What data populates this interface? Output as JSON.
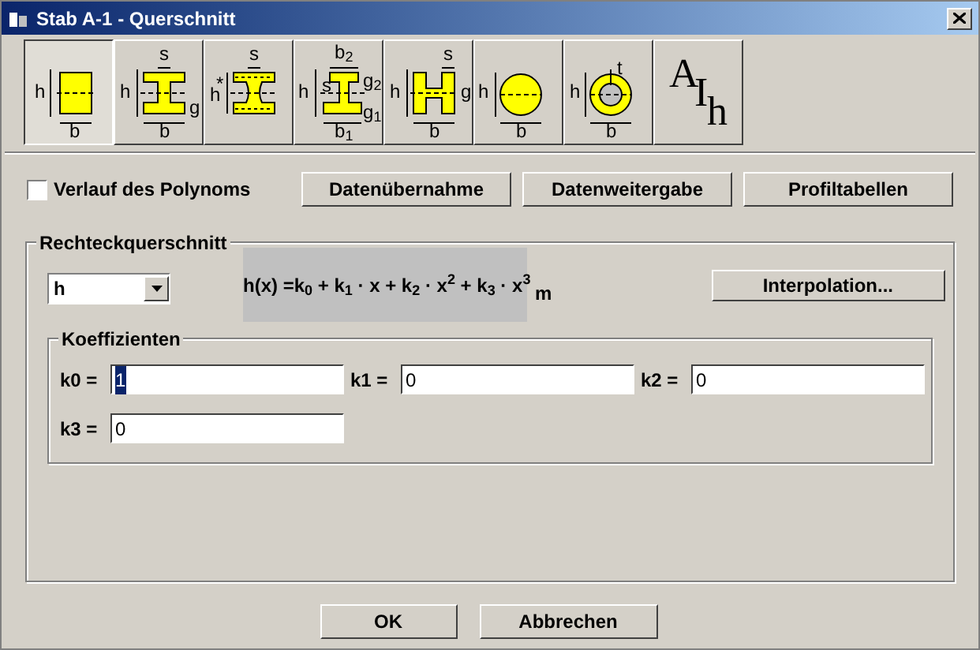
{
  "window": {
    "title": "Stab A-1 - Querschnitt"
  },
  "tools": [
    {
      "kind": "rect",
      "selected": true,
      "labels": [
        "h",
        "b"
      ]
    },
    {
      "kind": "ibeam",
      "selected": false,
      "labels": [
        "s",
        "h",
        "g",
        "b"
      ]
    },
    {
      "kind": "ibeam-dotted",
      "selected": false,
      "labels": [
        "s",
        "h",
        "*"
      ]
    },
    {
      "kind": "ibeam-asym",
      "selected": false,
      "labels": [
        "b$_{2}$",
        "h",
        "s",
        "g$_{2}$",
        "g$_{1}$",
        "b$_{1}$"
      ]
    },
    {
      "kind": "hbeam",
      "selected": false,
      "labels": [
        "s",
        "h",
        "g",
        "b"
      ]
    },
    {
      "kind": "circle",
      "selected": false,
      "labels": [
        "h",
        "b"
      ]
    },
    {
      "kind": "ring",
      "selected": false,
      "labels": [
        "t",
        "h",
        "b"
      ]
    },
    {
      "kind": "text",
      "selected": false,
      "labels": [
        "A",
        "I",
        "h"
      ]
    }
  ],
  "options": {
    "polynomial_checkbox": {
      "label": "Verlauf des Polynoms",
      "checked": false
    },
    "buttons": [
      "Datenübernahme",
      "Datenweitergabe",
      "Profiltabellen"
    ]
  },
  "section": {
    "title": "Rechteckquerschnitt",
    "dropdown": {
      "value": "h"
    },
    "formula": "h(x) =k$_{0}$ + k$_{1}$ · x + k$_{2}$ · x$^{2}$ + k$_{3}$ · x$^{3}$",
    "unit": "m",
    "interpolation_button": "Interpolation...",
    "coefficients": {
      "title": "Koeffizienten",
      "fields": [
        {
          "label": "k0 =",
          "value": "1",
          "focused": true
        },
        {
          "label": "k1 =",
          "value": "0",
          "focused": false
        },
        {
          "label": "k2 =",
          "value": "0",
          "focused": false
        },
        {
          "label": "k3 =",
          "value": "0",
          "focused": false
        }
      ]
    }
  },
  "footer_buttons": [
    "OK",
    "Abbrechen"
  ]
}
